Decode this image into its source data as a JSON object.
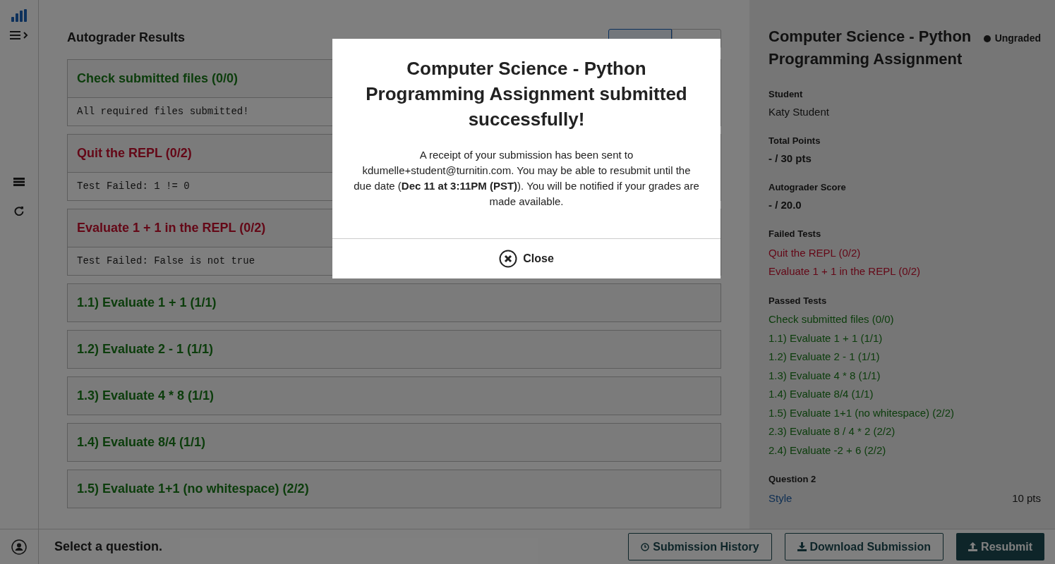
{
  "results": {
    "heading": "Autograder Results",
    "tabs": [
      {
        "selected": true
      },
      {
        "selected": false
      }
    ],
    "tests": [
      {
        "title": "Check submitted files (0/0)",
        "passed": true,
        "output": "All required files submitted!"
      },
      {
        "title": "Quit the REPL (0/2)",
        "passed": false,
        "output": "Test Failed: 1 != 0"
      },
      {
        "title": "Evaluate 1 + 1 in the REPL (0/2)",
        "passed": false,
        "output": "Test Failed: False is not true"
      },
      {
        "title": "1.1) Evaluate 1 + 1 (1/1)",
        "passed": true
      },
      {
        "title": "1.2) Evaluate 2 - 1 (1/1)",
        "passed": true
      },
      {
        "title": "1.3) Evaluate 4 * 8 (1/1)",
        "passed": true
      },
      {
        "title": "1.4) Evaluate 8/4 (1/1)",
        "passed": true
      },
      {
        "title": "1.5) Evaluate 1+1 (no whitespace) (2/2)",
        "passed": true
      }
    ]
  },
  "summary": {
    "title": "Computer Science - Python Programming Assignment",
    "status": "Ungraded",
    "fields": [
      {
        "label": "Student",
        "value": "Katy Student",
        "bold": false
      },
      {
        "label": "Total Points",
        "value": "- / 30 pts",
        "bold": true
      },
      {
        "label": "Autograder Score",
        "value": "- / 20.0",
        "bold": true
      }
    ],
    "failed": {
      "label": "Failed Tests",
      "items": [
        "Quit the REPL (0/2)",
        "Evaluate 1 + 1 in the REPL (0/2)"
      ]
    },
    "passed": {
      "label": "Passed Tests",
      "items": [
        "Check submitted files (0/0)",
        "1.1) Evaluate 1 + 1 (1/1)",
        "1.2) Evaluate 2 - 1 (1/1)",
        "1.3) Evaluate 4 * 8 (1/1)",
        "1.4) Evaluate 8/4 (1/1)",
        "1.5) Evaluate 1+1 (no whitespace) (2/2)",
        "2.3) Evaluate 8 / 4 * 2 (2/2)",
        "2.4) Evaluate -2 + 6 (2/2)"
      ]
    },
    "question": {
      "label": "Question 2",
      "link": "Style",
      "points": "10 pts"
    }
  },
  "footer": {
    "prompt": "Select a question.",
    "buttons": [
      {
        "label": "Submission History",
        "kind": "history"
      },
      {
        "label": "Download Submission",
        "kind": "download"
      },
      {
        "label": "Resubmit",
        "kind": "resubmit"
      }
    ]
  },
  "modal": {
    "title": "Computer Science - Python Programming Assignment submitted successfully!",
    "body": "A receipt of your submission has been sent to kdumelle+student@turnitin.com. You may be able to resubmit until the due date (**Dec 11 at 3:11PM (PST)**). You will be notified if your grades are made available.",
    "close": "Close"
  }
}
